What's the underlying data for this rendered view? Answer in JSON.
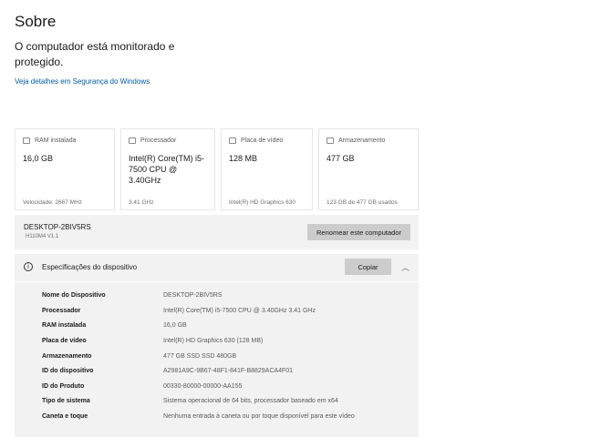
{
  "header": {
    "title": "Sobre",
    "status": "O computador está monitorado e protegido.",
    "security_link": "Veja detalhes em Segurança do Windows"
  },
  "cards": [
    {
      "icon": "ram-icon",
      "label": "RAM instalada",
      "value": "16,0 GB",
      "footer": "Velocidade: 2667 MHz"
    },
    {
      "icon": "processor-icon",
      "label": "Processador",
      "value": "Intel(R) Core(TM) i5-7500 CPU @ 3.40GHz",
      "footer": "3.41 GHz"
    },
    {
      "icon": "gpu-icon",
      "label": "Placa de vídeo",
      "value": "128 MB",
      "footer": "Intel(R) HD Graphics 630"
    },
    {
      "icon": "storage-icon",
      "label": "Armazenamento",
      "value": "477 GB",
      "footer": "123 GB de 477 GB usados"
    }
  ],
  "device": {
    "name": "DESKTOP-2BIV5RS",
    "model": "H110M4 V1.1",
    "rename_label": "Renomear este computador"
  },
  "specs": {
    "title": "Especificações do dispositivo",
    "copy_label": "Copiar",
    "rows": [
      {
        "key": "Nome do Dispositivo",
        "value": "DESKTOP-2BIV5RS"
      },
      {
        "key": "Processador",
        "value": "Intel(R) Core(TM) i5-7500 CPU @ 3.40GHz   3.41 GHz"
      },
      {
        "key": "RAM instalada",
        "value": "16,0 GB"
      },
      {
        "key": "Placa de vídeo",
        "value": "Intel(R) HD Graphics 630 (128 MB)"
      },
      {
        "key": "Armazenamento",
        "value": "477 GB SSD SSD 480GB"
      },
      {
        "key": "ID do dispositivo",
        "value": "A2981A9C-9B67-48F1-841F-B8829ACA4F01"
      },
      {
        "key": "ID do Produto",
        "value": "00330-80000-00000-AA155"
      },
      {
        "key": "Tipo de sistema",
        "value": "Sistema operacional de 64 bits, processador baseado em x64"
      },
      {
        "key": "Caneta e toque",
        "value": "Nenhuma entrada à caneta ou por toque disponível para este vídeo"
      }
    ]
  }
}
